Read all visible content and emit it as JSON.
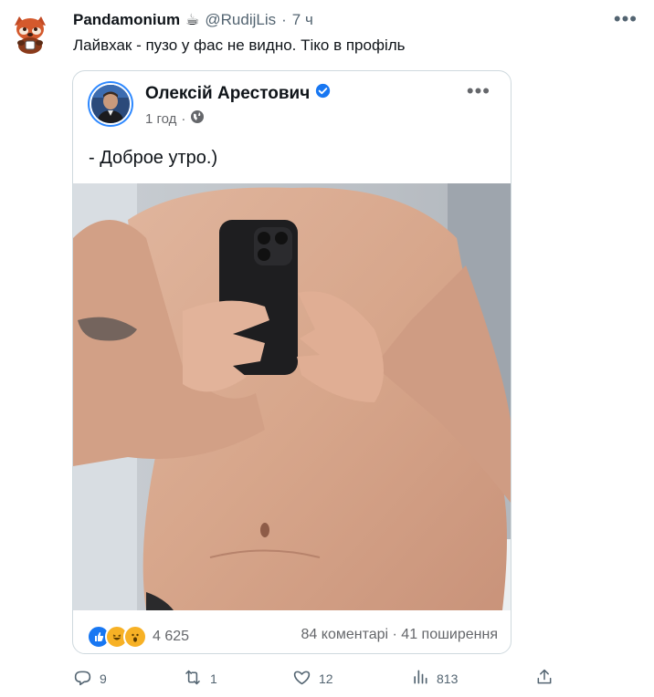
{
  "tweet": {
    "author_name": "Pandamonium",
    "author_emoji": "☕",
    "handle": "@RudijLis",
    "time": "7 ч",
    "text": "Лайвхак - пузо у фас не видно. Тіко в профіль"
  },
  "fb_post": {
    "author": "Олексій Арестович",
    "time": "1 год",
    "text": "- Доброе утро.)",
    "reactions_count": "4 625",
    "stats": "84 коментарі · 41 поширення"
  },
  "actions": {
    "replies": "9",
    "retweets": "1",
    "likes": "12",
    "views": "813"
  },
  "colors": {
    "accent": "#1d9bf0",
    "fb_blue": "#2d88ff",
    "muted": "#536471"
  }
}
